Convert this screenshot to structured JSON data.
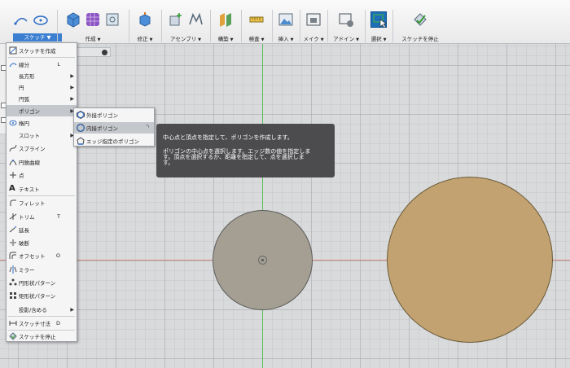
{
  "toolbar": {
    "groups": [
      {
        "label": "スケッチ",
        "active": true
      },
      {
        "label": "作成"
      },
      {
        "label": "修正"
      },
      {
        "label": "アセンブリ"
      },
      {
        "label": "構築"
      },
      {
        "label": "検査"
      },
      {
        "label": "挿入"
      },
      {
        "label": "メイク"
      },
      {
        "label": "アドイン"
      },
      {
        "label": "選択"
      },
      {
        "label": "スケッチを停止"
      }
    ],
    "dropdown_arrow": "▼"
  },
  "menu": {
    "items": [
      {
        "label": "スケッチを作成",
        "icon": "create-sketch-icon"
      },
      {
        "label": "線分",
        "key": "L",
        "icon": "line-icon"
      },
      {
        "label": "長方形",
        "sub": "▶"
      },
      {
        "label": "円",
        "sub": "▶"
      },
      {
        "label": "円弧",
        "sub": "▶"
      },
      {
        "label": "ポリゴン",
        "sub": "▶",
        "highlight": true
      },
      {
        "label": "楕円",
        "icon": "ellipse-icon"
      },
      {
        "label": "スロット",
        "sub": "▶"
      },
      {
        "label": "スプライン",
        "icon": "spline-icon"
      },
      {
        "label": "円錐曲線",
        "icon": "conic-curve-icon"
      },
      {
        "label": "点",
        "icon": "point-icon"
      },
      {
        "label": "テキスト",
        "icon": "text-icon"
      },
      {
        "label": "フィレット",
        "icon": "fillet-icon"
      },
      {
        "label": "トリム",
        "key": "T",
        "icon": "trim-icon"
      },
      {
        "label": "延長",
        "icon": "extend-icon"
      },
      {
        "label": "破断",
        "icon": "break-icon"
      },
      {
        "label": "オフセット",
        "key": "O",
        "icon": "offset-icon"
      },
      {
        "label": "ミラー",
        "icon": "mirror-icon"
      },
      {
        "label": "円形状パターン",
        "icon": "circular-pattern-icon"
      },
      {
        "label": "矩形状パターン",
        "icon": "rectangular-pattern-icon"
      },
      {
        "label": "投影/含める",
        "sub": "▶"
      },
      {
        "label": "スケッチ寸法",
        "key": "D",
        "icon": "sketch-dimension-icon"
      },
      {
        "label": "スケッチを停止",
        "icon": "stop-sketch-icon"
      }
    ]
  },
  "submenu": {
    "items": [
      {
        "label": "外接ポリゴン",
        "icon": "circumscribed-polygon-icon"
      },
      {
        "label": "内接ポリゴン",
        "icon": "inscribed-polygon-icon",
        "highlight": true
      },
      {
        "label": "エッジ指定のポリゴン",
        "icon": "edge-polygon-icon"
      }
    ]
  },
  "tooltip": {
    "line1": "中心点と頂点を指定して、ポリゴンを作成します。",
    "line2": "ポリゴンの中心点を選択します。エッジ数の値を指定しま",
    "line3": "す。頂点を選択するか、距離を指定して、点を選択しま",
    "line4": "す。"
  },
  "colors": {
    "accent": "#3c7fd0",
    "menu_highlight": "#c4c7cb",
    "tooltip_bg": "#4c4c4f",
    "small_circle": "#a49f92",
    "large_circle": "#c1a270",
    "green_axis": "#5cbf5c",
    "red_axis": "#d58a80"
  }
}
